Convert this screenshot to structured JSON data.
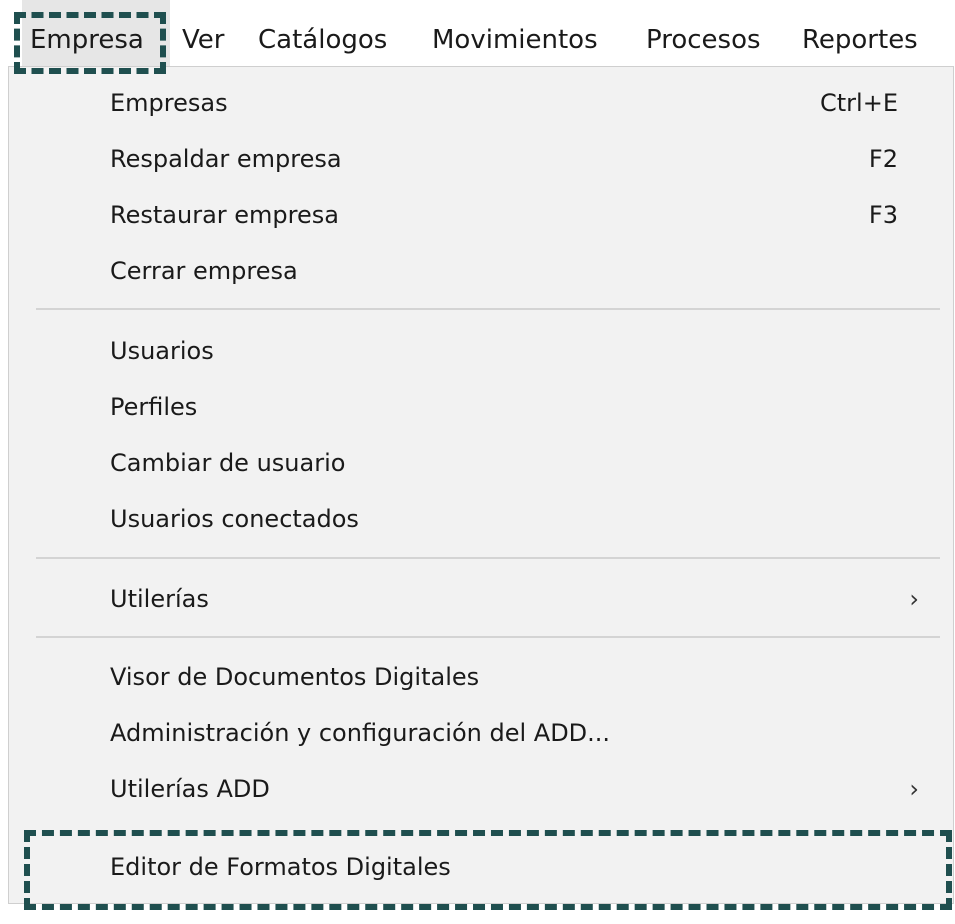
{
  "menubar": {
    "items": [
      {
        "label": "Empresa",
        "active": true
      },
      {
        "label": "Ver"
      },
      {
        "label": "Catálogos"
      },
      {
        "label": "Movimientos"
      },
      {
        "label": "Procesos"
      },
      {
        "label": "Reportes"
      }
    ]
  },
  "dropdown": {
    "groups": [
      [
        {
          "label": "Empresas",
          "shortcut": "Ctrl+E"
        },
        {
          "label": "Respaldar empresa",
          "shortcut": "F2"
        },
        {
          "label": "Restaurar empresa",
          "shortcut": "F3"
        },
        {
          "label": "Cerrar empresa"
        }
      ],
      [
        {
          "label": "Usuarios"
        },
        {
          "label": "Perfiles"
        },
        {
          "label": "Cambiar de usuario"
        },
        {
          "label": "Usuarios conectados"
        }
      ],
      [
        {
          "label": "Utilerías",
          "submenu_icon": "›"
        }
      ],
      [
        {
          "label": "Visor de Documentos Digitales"
        },
        {
          "label": "Administración y configuración del ADD..."
        },
        {
          "label": "Utilerías ADD",
          "submenu_icon": "›"
        },
        {
          "label": "Editor de Formatos Digitales",
          "highlighted": true
        }
      ]
    ]
  },
  "colors": {
    "callout": "#1f4f4f",
    "menu_background": "#f2f2f2",
    "active_menubar_background": "#e6e6e6",
    "separator": "#d4d4d4"
  }
}
